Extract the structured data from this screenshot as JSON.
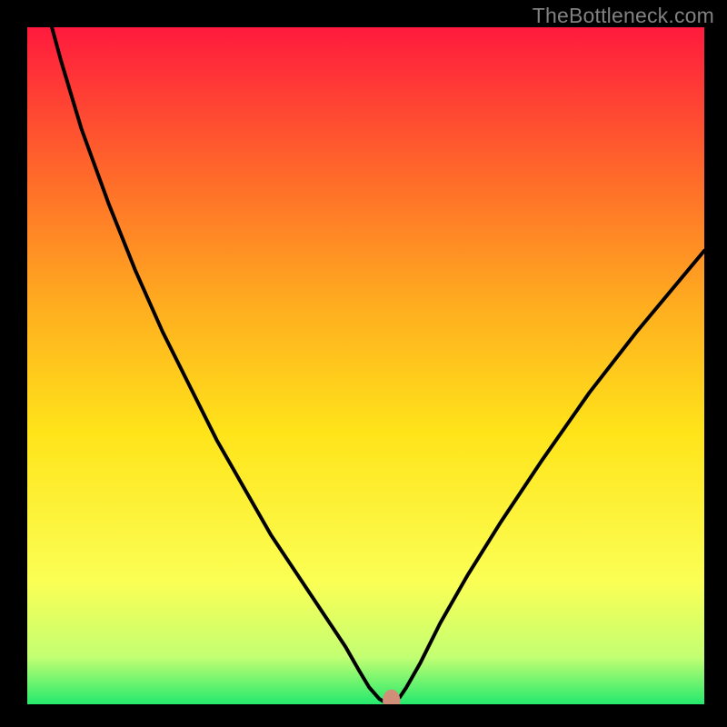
{
  "watermark": "TheBottleneck.com",
  "chart_data": {
    "type": "line",
    "title": "",
    "xlabel": "",
    "ylabel": "",
    "xlim": [
      0,
      100
    ],
    "ylim": [
      0,
      100
    ],
    "grid": false,
    "legend": false,
    "background_gradient_top_to_bottom": [
      "#ff1a3d",
      "#ff6a2a",
      "#ffb01f",
      "#ffe41a",
      "#fbff55",
      "#c3ff72",
      "#24e96d"
    ],
    "series": [
      {
        "name": "bottleneck_curve",
        "color": "#000000",
        "x": [
          0,
          2,
          5,
          8,
          12,
          16,
          20,
          24,
          28,
          32,
          36,
          40,
          44,
          47,
          49,
          50.5,
          52,
          53,
          53.8,
          55,
          56,
          58,
          61,
          65,
          70,
          76,
          83,
          90,
          100
        ],
        "y": [
          115,
          106,
          95,
          85,
          74,
          64,
          55,
          47,
          39,
          32,
          25,
          19,
          13,
          8.5,
          5,
          2.5,
          0.8,
          0.2,
          0.15,
          1,
          2.5,
          6,
          12,
          19,
          27,
          36,
          46,
          55,
          67
        ]
      }
    ],
    "marker": {
      "name": "optimal_point",
      "shape": "ellipse",
      "color": "#cf8f79",
      "x": 53.8,
      "y": 0.5,
      "rx": 1.3,
      "ry": 1.7
    }
  }
}
